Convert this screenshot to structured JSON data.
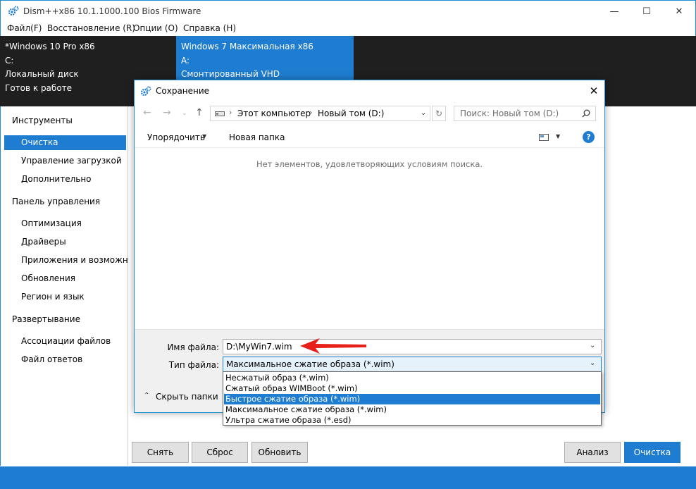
{
  "window": {
    "title": "Dism++x86 10.1.1000.100 Bios Firmware",
    "minimize": "—",
    "maximize": "☐",
    "close": "✕"
  },
  "menu": [
    "Файл(F)",
    "Восстановление (R)",
    "Опции (O)",
    "Справка (H)"
  ],
  "images": [
    {
      "name": "*Windows 10 Pro x86",
      "drive": "C:",
      "type": "Локальный диск",
      "status": "Готов к работе"
    },
    {
      "name": "Windows 7 Максимальная x86",
      "drive": "A:",
      "type": "Смонтированный VHD",
      "status": ""
    }
  ],
  "sidebar": {
    "sections": [
      {
        "title": "Инструменты",
        "items": [
          "Очистка",
          "Управление загрузкой",
          "Дополнительно"
        ]
      },
      {
        "title": "Панель управления",
        "items": [
          "Оптимизация",
          "Драйверы",
          "Приложения и возможнос",
          "Обновления",
          "Регион и язык"
        ]
      },
      {
        "title": "Развертывание",
        "items": [
          "Ассоциации файлов",
          "Файл ответов"
        ]
      }
    ],
    "active": "Очистка"
  },
  "buttons": {
    "remove": "Снять",
    "reset": "Сброс",
    "refresh": "Обновить",
    "analyze": "Анализ",
    "clean": "Очистка"
  },
  "dialog": {
    "title": "Сохранение",
    "close": "✕",
    "breadcrumb": [
      "Этот компьютер",
      "Новый том (D:)"
    ],
    "search_placeholder": "Поиск: Новый том (D:)",
    "organize": "Упорядочить",
    "new_folder": "Новая папка",
    "empty_message": "Нет элементов, удовлетворяющих условиям поиска.",
    "filename_label": "Имя файла:",
    "filename_value": "D:\\MyWin7.wim",
    "filetype_label": "Тип файла:",
    "filetype_value": "Максимальное сжатие образа (*.wim)",
    "hide_folders": "Скрыть папки",
    "filetype_options": [
      "Несжатый образ (*.wim)",
      "Сжатый образ WIMBoot (*.wim)",
      "Быстрое сжатие образа (*.wim)",
      "Максимальное сжатие образа (*.wim)",
      "Ультра сжатие образа (*.esd)"
    ],
    "highlighted_option_index": 2
  },
  "colors": {
    "accent": "#1e7dd1",
    "dark_panel": "#1f1f1f",
    "annotation_arrow": "#e8201a"
  }
}
